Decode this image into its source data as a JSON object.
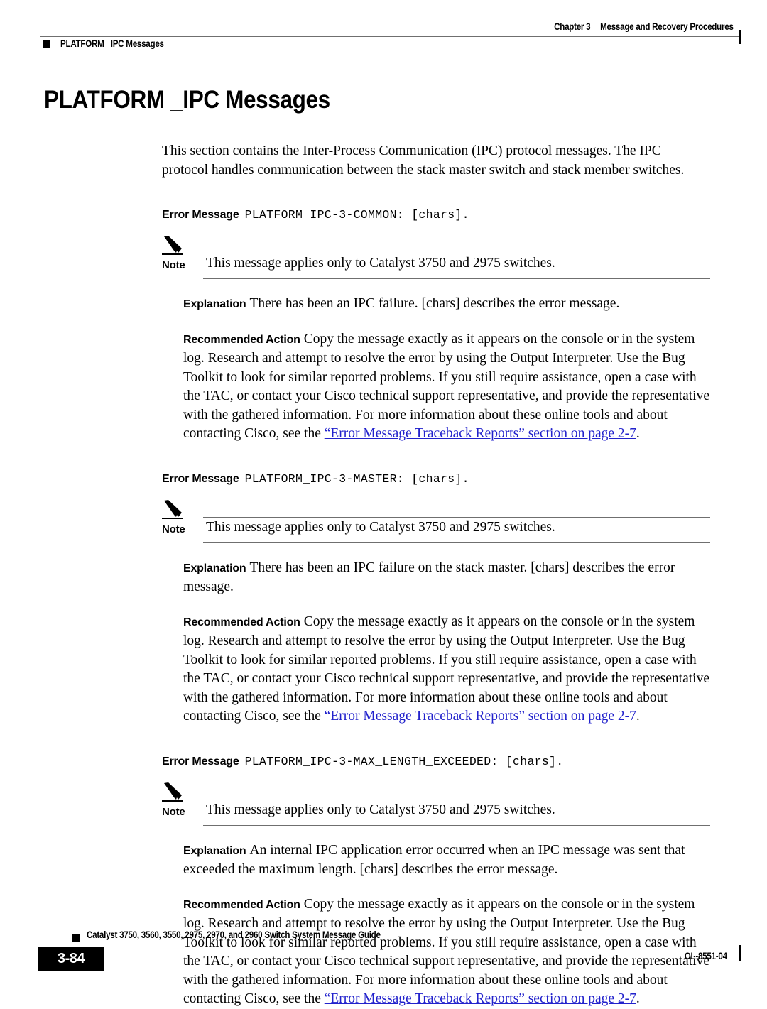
{
  "header": {
    "chapter_label": "Chapter 3",
    "chapter_title": "Message and Recovery Procedures",
    "section_crumb": "PLATFORM _IPC Messages"
  },
  "page": {
    "title": "PLATFORM _IPC Messages",
    "intro": "This section contains the Inter-Process Communication (IPC) protocol messages. The IPC protocol handles communication between the stack master switch and stack member switches."
  },
  "labels": {
    "error_message": "Error Message",
    "note": "Note",
    "explanation": "Explanation",
    "recommended_action": "Recommended Action"
  },
  "messages": [
    {
      "id": "PLATFORM_IPC-3-COMMON: [chars].",
      "note": "This message applies only to Catalyst 3750 and 2975 switches.",
      "explanation": "There has been an IPC failure. [chars] describes the error message.",
      "action_text": "Copy the message exactly as it appears on the console or in the system log. Research and attempt to resolve the error by using the Output Interpreter. Use the Bug Toolkit to look for similar reported problems. If you still require assistance, open a case with the TAC, or contact your Cisco technical support representative, and provide the representative with the gathered information. For more information about these online tools and about contacting Cisco, see the ",
      "action_link": "“Error Message Traceback Reports” section on page 2-7",
      "action_tail": "."
    },
    {
      "id": "PLATFORM_IPC-3-MASTER: [chars].",
      "note": "This message applies only to Catalyst 3750 and 2975 switches.",
      "explanation": "There has been an IPC failure on the stack master. [chars] describes the error message.",
      "action_text": "Copy the message exactly as it appears on the console or in the system log. Research and attempt to resolve the error by using the Output Interpreter. Use the Bug Toolkit to look for similar reported problems. If you still require assistance, open a case with the TAC, or contact your Cisco technical support representative, and provide the representative with the gathered information. For more information about these online tools and about contacting Cisco, see the ",
      "action_link": "“Error Message Traceback Reports” section on page 2-7",
      "action_tail": "."
    },
    {
      "id": "PLATFORM_IPC-3-MAX_LENGTH_EXCEEDED: [chars].",
      "note": "This message applies only to Catalyst 3750 and 2975 switches.",
      "explanation": "An internal IPC application error occurred when an IPC message was sent that exceeded the maximum length. [chars] describes the error message.",
      "action_text": "Copy the message exactly as it appears on the console or in the system log. Research and attempt to resolve the error by using the Output Interpreter. Use the Bug Toolkit to look for similar reported problems. If you still require assistance, open a case with the TAC, or contact your Cisco technical support representative, and provide the representative with the gathered information. For more information about these online tools and about contacting Cisco, see the ",
      "action_link": "“Error Message Traceback Reports” section on page 2-7",
      "action_tail": "."
    }
  ],
  "footer": {
    "guide_title": "Catalyst 3750, 3560, 3550, 2975, 2970, and 2960 Switch System Message Guide",
    "page_number": "3-84",
    "doc_id": "OL-8551-04"
  },
  "colors": {
    "link": "#2222cc",
    "rule": "#6f6f6f",
    "text": "#000000"
  }
}
